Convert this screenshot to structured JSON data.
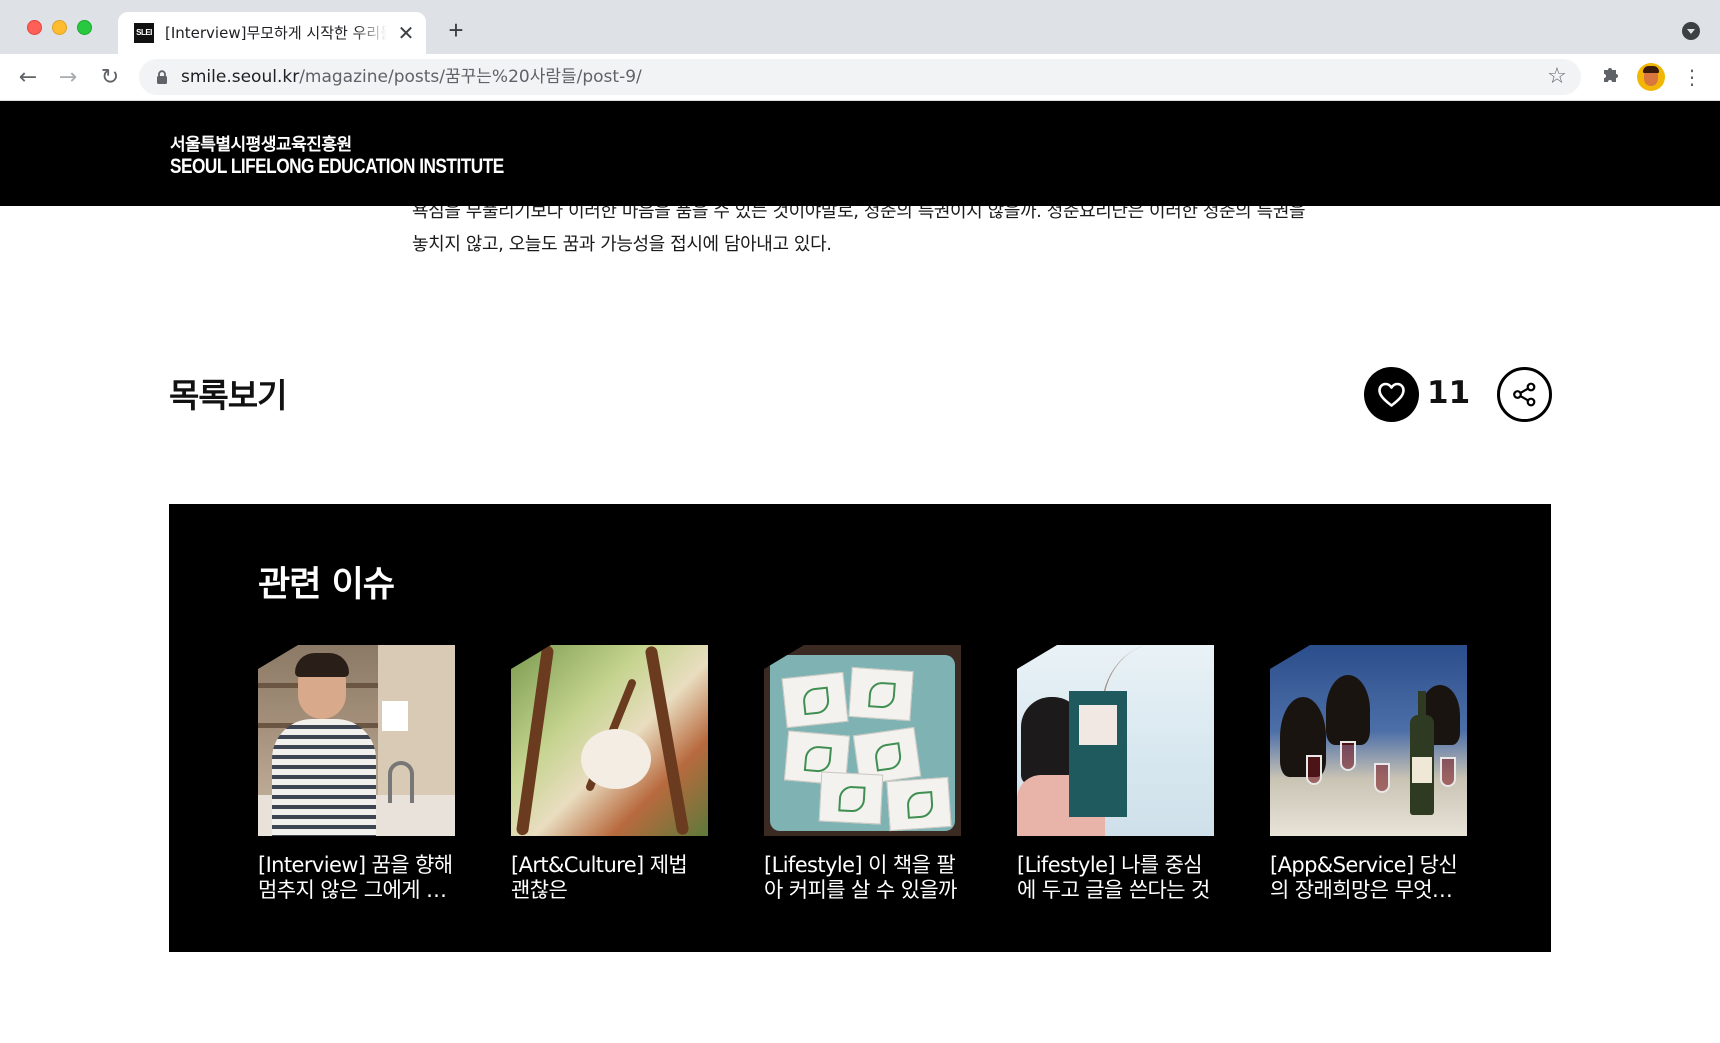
{
  "browser": {
    "tab": {
      "favicon_text": "SLEI",
      "title": "[Interview]무모하게 시작한 우리들의 청춘요리단",
      "close_glyph": "✕"
    },
    "new_tab_glyph": "+",
    "url": {
      "host": "smile.seoul.kr",
      "path": "/magazine/posts/꿈꾸는%20사람들/post-9/"
    },
    "icons": {
      "back": "←",
      "forward": "→",
      "reload": "↻",
      "star": "☆",
      "extensions": "✦",
      "menu": "⋮"
    }
  },
  "site": {
    "logo_ko": "서울특별시평생교육진흥원",
    "logo_en": "SEOUL LIFELONG EDUCATION INSTITUTE"
  },
  "article": {
    "text": "욕심을 부풀리기보다 이러한 마음을 품을 수 있는 것이야말로, 청춘의 특권이지 않을까. 청춘요리단은 이러한 청춘의 특권을 놓치지 않고, 오늘도 꿈과 가능성을 접시에 담아내고 있다."
  },
  "actions": {
    "list_label": "목록보기",
    "like_count": "11"
  },
  "related": {
    "title": "관련 이슈",
    "items": [
      {
        "title": "[Interview] 꿈을 향해 멈추지 않은 그에게 묻다"
      },
      {
        "title": "[Art&Culture] 제법 괜찮은"
      },
      {
        "title": "[Lifestyle] 이 책을 팔아 커피를 살 수 있을까"
      },
      {
        "title": "[Lifestyle] 나를 중심에 두고 글을 쓴다는 것"
      },
      {
        "title": "[App&Service] 당신의 장래희망은 무엇인가요"
      }
    ]
  },
  "colors": {
    "header_bg": "#000000",
    "related_bg": "#000000",
    "text": "#111111"
  }
}
